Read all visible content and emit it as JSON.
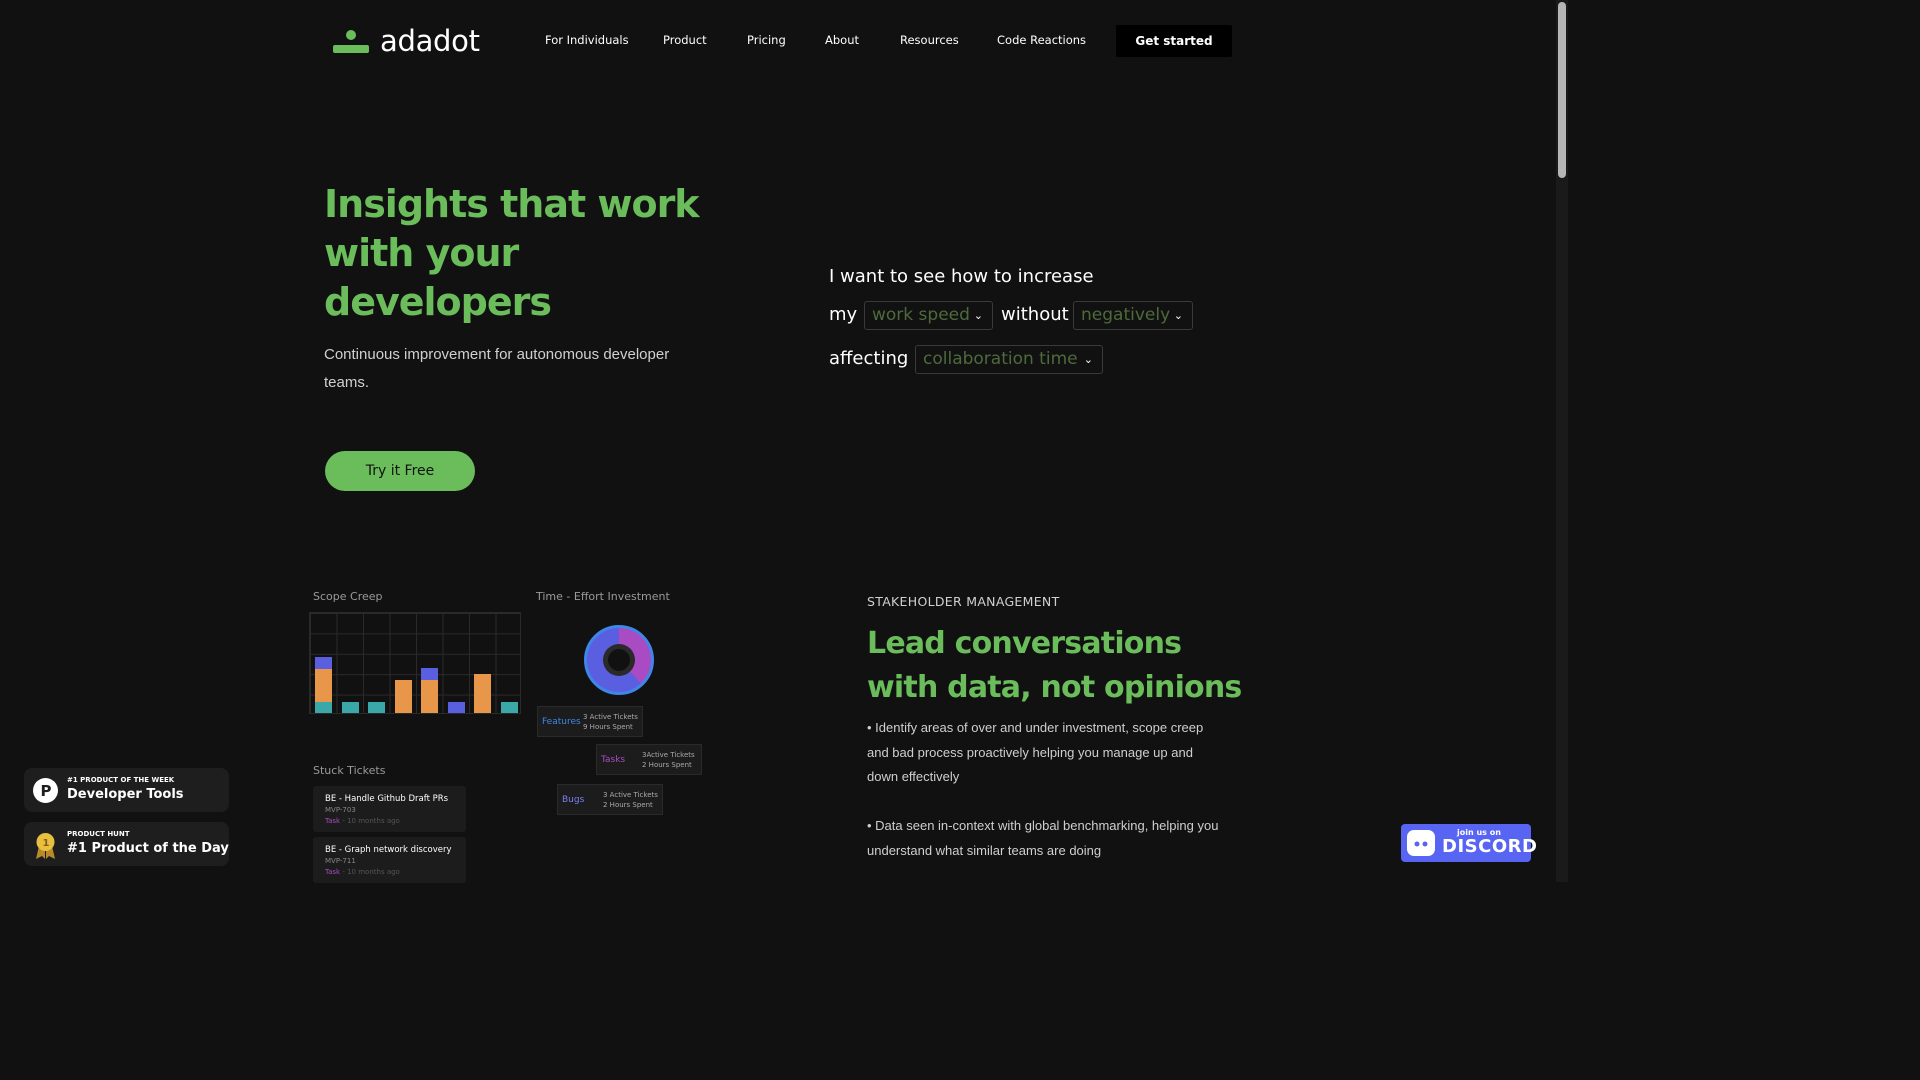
{
  "brand": {
    "name": "adadot",
    "accent": "#6bbd5b",
    "background": "#111111"
  },
  "nav": [
    {
      "label": "For Individuals"
    },
    {
      "label": "Product"
    },
    {
      "label": "Pricing"
    },
    {
      "label": "About"
    },
    {
      "label": "Resources"
    },
    {
      "label": "Code Reactions"
    }
  ],
  "header": {
    "cta_label": "Get started"
  },
  "hero": {
    "title": "Insights that work with your developers",
    "subtitle": "Continuous improvement for autonomous developer teams.",
    "button_label": "Try it Free"
  },
  "configurator": {
    "line1": "I want to see how to increase",
    "my": "my",
    "metric": "work speed",
    "without": "without",
    "impact": "negatively",
    "affecting": "affecting",
    "area": "collaboration time"
  },
  "charts": {
    "scope_creep_label": "Scope Creep",
    "effort_label": "Time - Effort Investment",
    "stuck_label": "Stuck Tickets",
    "series_colors": {
      "orange": "#e8974a",
      "teal": "#3aa7a8",
      "purple": "#5a5fe0",
      "blue": "#3f86e8",
      "magenta": "#a94bc2"
    },
    "effort_cards": [
      {
        "name": "Features",
        "color": "#3f86e8",
        "line1": "3 Active Tickets",
        "line2": "9 Hours Spent"
      },
      {
        "name": "Tasks",
        "color": "#a94bc2",
        "line1": "3Active Tickets",
        "line2": "2 Hours Spent"
      },
      {
        "name": "Bugs",
        "color": "#7a7ff0",
        "line1": "3 Active Tickets",
        "line2": "2 Hours Spent"
      }
    ],
    "stuck_tickets": [
      {
        "title": "BE - Handle Github Draft PRs",
        "id": "MVP-703",
        "type": "Task",
        "age": "10 months ago"
      },
      {
        "title": "BE - Graph network discovery",
        "id": "MVP-711",
        "type": "Task",
        "age": "10 months ago"
      }
    ]
  },
  "stakeholder": {
    "eyebrow": "STAKEHOLDER MANAGEMENT",
    "title": "Lead conversations with data, not opinions",
    "bullet1": "• Identify areas of over and under investment, scope creep and bad process proactively helping you manage up and down effectively",
    "bullet2": "• Data seen in-context with global benchmarking, helping you understand what similar teams are doing"
  },
  "badges": [
    {
      "top": "#1 PRODUCT OF THE WEEK",
      "main": "Developer Tools",
      "icon": "producthunt-p-icon"
    },
    {
      "top": "PRODUCT HUNT",
      "main": "#1 Product of the Day",
      "icon": "medal-icon"
    }
  ],
  "discord": {
    "small": "join us on",
    "big": "DISCORD"
  }
}
